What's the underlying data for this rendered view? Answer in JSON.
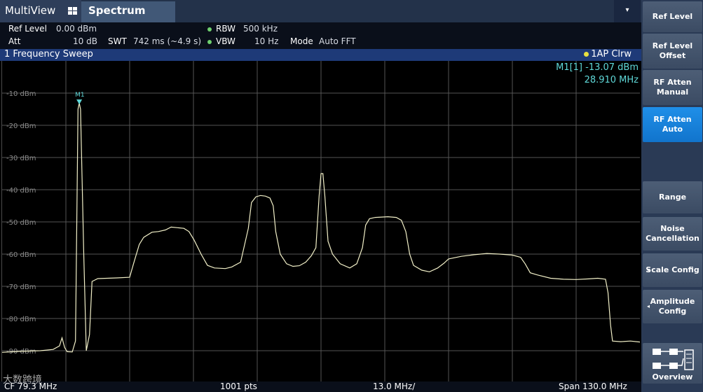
{
  "tabs": {
    "multiview": "MultiView",
    "spectrum": "Spectrum",
    "dropdown": "▾"
  },
  "params": {
    "ref_level_label": "Ref Level",
    "ref_level_value": "0.00 dBm",
    "att_label": "Att",
    "att_value": "10 dB",
    "swt_label": "SWT",
    "swt_value": "742 ms (~4.9 s)",
    "rbw_label": "RBW",
    "rbw_value": "500 kHz",
    "vbw_label": "VBW",
    "vbw_value": "10 Hz",
    "mode_label": "Mode",
    "mode_value": "Auto FFT"
  },
  "sweep": {
    "title": "1 Frequency Sweep",
    "trace": "1AP Clrw"
  },
  "marker": {
    "label": "M1",
    "readout_name": "M1[1]",
    "readout_level": "-13.07 dBm",
    "readout_freq": "28.910 MHz"
  },
  "y_axis_labels": [
    "-10 dBm",
    "-20 dBm",
    "-30 dBm",
    "-40 dBm",
    "-50 dBm",
    "-60 dBm",
    "-70 dBm",
    "-80 dBm",
    "-90 dBm"
  ],
  "footer": {
    "cf": "CF 79.3 MHz",
    "pts": "1001 pts",
    "div": "13.0 MHz/",
    "span": "Span 130.0 MHz"
  },
  "watermark": "大数跨境",
  "softkeys": [
    {
      "label": "Ref Level",
      "active": false
    },
    {
      "label": "Ref Level Offset",
      "active": false
    },
    {
      "label": "RF Atten Manual",
      "active": false
    },
    {
      "label": "RF Atten Auto",
      "active": true
    },
    {
      "label": "",
      "active": false
    },
    {
      "label": "Range",
      "active": false
    },
    {
      "label": "Noise Cancellation",
      "active": false
    },
    {
      "label": "Scale Config",
      "active": false
    },
    {
      "label": "Amplitude Config",
      "active": false
    },
    {
      "label": "Overview",
      "active": false
    }
  ],
  "trace_points": [
    [
      0,
      -90.5
    ],
    [
      3,
      -90.2
    ],
    [
      6,
      -90
    ],
    [
      8,
      -89.6
    ],
    [
      9,
      -88.5
    ],
    [
      9.4,
      -86
    ],
    [
      9.8,
      -89
    ],
    [
      10.2,
      -90.3
    ],
    [
      11,
      -90.4
    ],
    [
      11.5,
      -87
    ],
    [
      11.9,
      -15
    ],
    [
      12.1,
      -13.07
    ],
    [
      12.3,
      -15
    ],
    [
      12.8,
      -60
    ],
    [
      13.2,
      -90
    ],
    [
      13.7,
      -85
    ],
    [
      14.1,
      -68.5
    ],
    [
      15,
      -67.6
    ],
    [
      18,
      -67.4
    ],
    [
      20,
      -67.2
    ],
    [
      20.6,
      -63
    ],
    [
      21.5,
      -57
    ],
    [
      22.2,
      -54.8
    ],
    [
      23.5,
      -53.2
    ],
    [
      24.5,
      -53
    ],
    [
      25.6,
      -52.5
    ],
    [
      26.5,
      -51.6
    ],
    [
      27.5,
      -51.8
    ],
    [
      28.5,
      -52
    ],
    [
      29.3,
      -53
    ],
    [
      30.1,
      -55.6
    ],
    [
      31.2,
      -60
    ],
    [
      32.2,
      -63.5
    ],
    [
      33.3,
      -64.3
    ],
    [
      35,
      -64.5
    ],
    [
      36,
      -64
    ],
    [
      37.4,
      -62.5
    ],
    [
      38.6,
      -52
    ],
    [
      39.1,
      -44
    ],
    [
      39.8,
      -42.2
    ],
    [
      40.5,
      -41.8
    ],
    [
      41.3,
      -42
    ],
    [
      42,
      -42.6
    ],
    [
      42.5,
      -45
    ],
    [
      42.9,
      -53
    ],
    [
      43.6,
      -60
    ],
    [
      44.6,
      -63
    ],
    [
      45.6,
      -63.8
    ],
    [
      46.6,
      -63.6
    ],
    [
      47.6,
      -62.5
    ],
    [
      48.5,
      -60.5
    ],
    [
      49.2,
      -58
    ],
    [
      49.7,
      -42
    ],
    [
      50,
      -35
    ],
    [
      50.3,
      -35
    ],
    [
      50.6,
      -42
    ],
    [
      51.1,
      -56
    ],
    [
      51.8,
      -60
    ],
    [
      53,
      -63
    ],
    [
      54.5,
      -64.3
    ],
    [
      55.6,
      -63
    ],
    [
      56.5,
      -58
    ],
    [
      57,
      -51
    ],
    [
      57.6,
      -49
    ],
    [
      58.5,
      -48.6
    ],
    [
      60.5,
      -48.4
    ],
    [
      61.8,
      -48.6
    ],
    [
      62.6,
      -49.5
    ],
    [
      63.3,
      -53
    ],
    [
      63.9,
      -60
    ],
    [
      64.5,
      -63.5
    ],
    [
      65.8,
      -65
    ],
    [
      67,
      -65.5
    ],
    [
      68.3,
      -64.3
    ],
    [
      69.3,
      -62.8
    ],
    [
      70,
      -61.5
    ],
    [
      72,
      -60.7
    ],
    [
      74,
      -60.2
    ],
    [
      76,
      -59.8
    ],
    [
      78,
      -60
    ],
    [
      80,
      -60.3
    ],
    [
      81.3,
      -61
    ],
    [
      82,
      -63
    ],
    [
      82.8,
      -65.8
    ],
    [
      84,
      -66.5
    ],
    [
      86,
      -67.5
    ],
    [
      88,
      -67.8
    ],
    [
      90,
      -67.9
    ],
    [
      92,
      -67.7
    ],
    [
      93.4,
      -67.5
    ],
    [
      94.6,
      -67.8
    ],
    [
      95,
      -72
    ],
    [
      95.4,
      -82
    ],
    [
      95.7,
      -87
    ],
    [
      97,
      -87.2
    ],
    [
      98.5,
      -87
    ],
    [
      100,
      -87.3
    ]
  ]
}
